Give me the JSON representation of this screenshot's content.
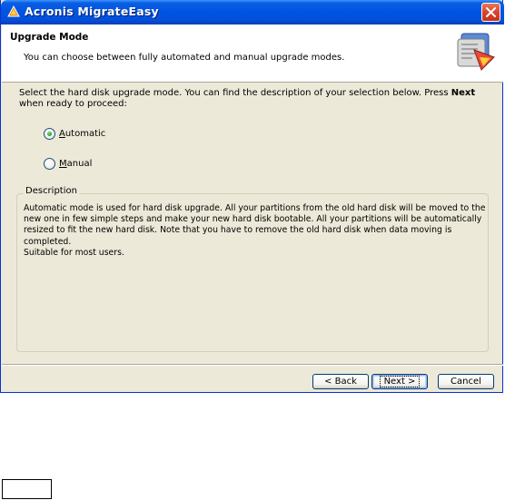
{
  "window": {
    "title": "Acronis MigrateEasy"
  },
  "header": {
    "title": "Upgrade Mode",
    "subtitle": "You can choose between fully automated and manual upgrade modes.",
    "logo_icon": "acronis-wizard-logo-icon"
  },
  "instruction": {
    "prefix": "Select the hard disk upgrade mode. You can find the description of your selection below. Press ",
    "emphasis": "Next",
    "suffix": " when ready to proceed:"
  },
  "options": [
    {
      "accel": "A",
      "rest": "utomatic",
      "checked": true
    },
    {
      "accel": "M",
      "rest": "anual",
      "checked": false
    }
  ],
  "description": {
    "legend": "Description",
    "paragraph": "Automatic mode is used for hard disk upgrade. All your partitions from the old hard disk will be moved to the new one in few simple steps and make your new hard disk bootable. All your partitions will be automatically resized to fit the new hard disk. Note that you have to remove the old hard disk when data moving is completed.",
    "note": "Suitable for most users."
  },
  "buttons": {
    "back": "< Back",
    "next": "Next >",
    "cancel": "Cancel"
  },
  "colors": {
    "titlebar": "#0054e3",
    "window_bg": "#ece9d8",
    "close_button": "#d9442b",
    "radio_checked": "#2fa52f"
  }
}
